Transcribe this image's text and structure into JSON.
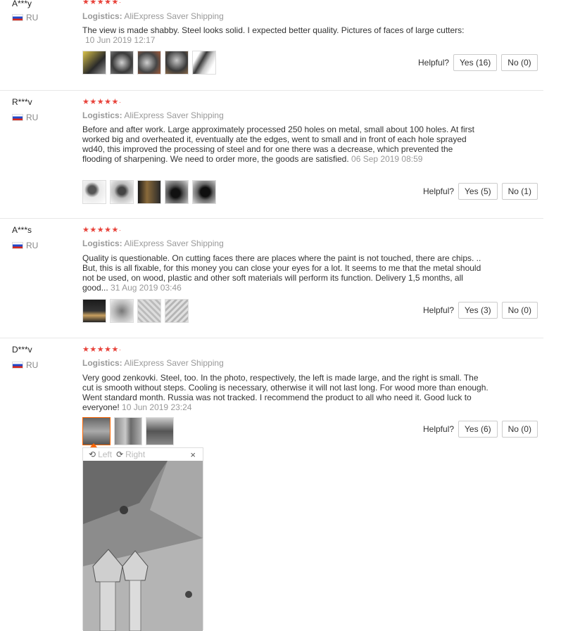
{
  "colors": {
    "star": "#e8423a",
    "accent": "#ff6600",
    "flag": [
      "#ffffff",
      "#2149c9",
      "#d8281d"
    ]
  },
  "helpful_label": "Helpful?",
  "viewer": {
    "left_label": "Left",
    "right_label": "Right",
    "close_label": "×",
    "rotate_icon": "rotate-icon"
  },
  "reviews": [
    {
      "user": "A***y",
      "country": "RU",
      "stars": "★★★★★",
      "logistics_label": "Logistics:",
      "logistics": "AliExpress Saver Shipping",
      "text": "The view is made shabby. Steel looks solid. I expected better quality. Pictures of faces of large cutters:",
      "date": "10 Jun 2019 12:17",
      "yes": "Yes (16)",
      "no": "No (0)"
    },
    {
      "user": "R***v",
      "country": "RU",
      "stars": "★★★★★",
      "logistics_label": "Logistics:",
      "logistics": "AliExpress Saver Shipping",
      "text": "Before and after work. Large approximately processed 250 holes on metal, small about 100 holes. At first worked big and overheated it, eventually ate the edges, went to small and in front of each hole sprayed wd40, this improved the processing of steel and for one there was a decrease, which prevented the flooding of sharpening. We need to order more, the goods are satisfied.",
      "date": "06 Sep 2019 08:59",
      "yes": "Yes (5)",
      "no": "No (1)"
    },
    {
      "user": "A***s",
      "country": "RU",
      "stars": "★★★★★",
      "logistics_label": "Logistics:",
      "logistics": "AliExpress Saver Shipping",
      "text": "Quality is questionable. On cutting faces there are places where the paint is not touched, there are chips. .. But, this is all fixable, for this money you can close your eyes for a lot. It seems to me that the metal should not be used, on wood, plastic and other soft materials will perform its function. Delivery 1,5 months, all good...",
      "date": "31 Aug 2019 03:46",
      "yes": "Yes (3)",
      "no": "No (0)"
    },
    {
      "user": "D***v",
      "country": "RU",
      "stars": "★★★★★",
      "logistics_label": "Logistics:",
      "logistics": "AliExpress Saver Shipping",
      "text": "Very good zenkovki. Steel, too. In the photo, respectively, the left is made large, and the right is small. The cut is smooth without steps. Cooling is necessary, otherwise it will not last long. For wood more than enough. Went standard month. Russia was not tracked. I recommend the product to all who need it. Good luck to everyone!",
      "date": "10 Jun 2019 23:24",
      "yes": "Yes (6)",
      "no": "No (0)"
    }
  ]
}
